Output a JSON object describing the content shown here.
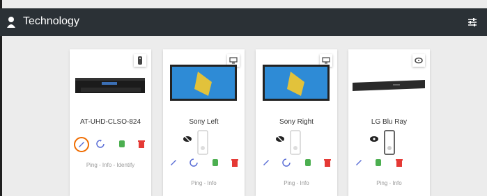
{
  "header": {
    "title": "Technology",
    "settings_icon": "sliders-icon",
    "user_icon": "user-icon"
  },
  "colors": {
    "topbar": "#2b3136",
    "edit": "#5b6ed6",
    "refresh": "#5b6ed6",
    "power": "#4caf50",
    "delete": "#e53935",
    "highlight": "#ef6c00"
  },
  "devices": [
    {
      "name": "AT-UHD-CLSO-824",
      "type_icon": "remote-control-icon",
      "links": "Ping - Info - Identify"
    },
    {
      "name": "Sony Left",
      "type_icon": "monitor-icon",
      "links": "Ping - Info"
    },
    {
      "name": "Sony Right",
      "type_icon": "monitor-icon",
      "links": "Ping - Info"
    },
    {
      "name": "LG Blu Ray",
      "type_icon": "disc-icon",
      "links": "Ping - Info"
    }
  ]
}
